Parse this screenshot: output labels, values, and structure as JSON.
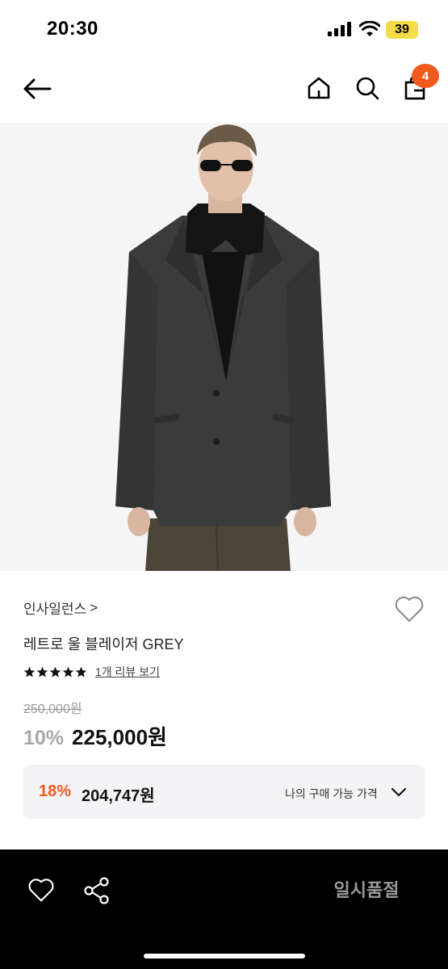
{
  "status": {
    "time": "20:30",
    "battery": "39"
  },
  "nav": {
    "cart_count": "4",
    "icons": [
      "back-arrow-icon",
      "home-icon",
      "search-icon",
      "shopping-bag-icon"
    ]
  },
  "product": {
    "brand": "인사일런스",
    "brand_chevron": ">",
    "name": "레트로 울 블레이저 GREY",
    "rating_stars": 5,
    "review_link": "1개 리뷰 보기",
    "original_price": "250,000원",
    "discount_rate": "10%",
    "sale_price": "225,000원"
  },
  "best_price": {
    "rate": "18%",
    "price": "204,747원",
    "label": "나의 구매 가능 가격"
  },
  "bottom_bar": {
    "soldout_label": "일시품절"
  },
  "colors": {
    "accent": "#f25a1d",
    "badge_battery": "#f5dd45",
    "bottom_bg": "#000000",
    "muted_price": "#a8a8a8"
  }
}
